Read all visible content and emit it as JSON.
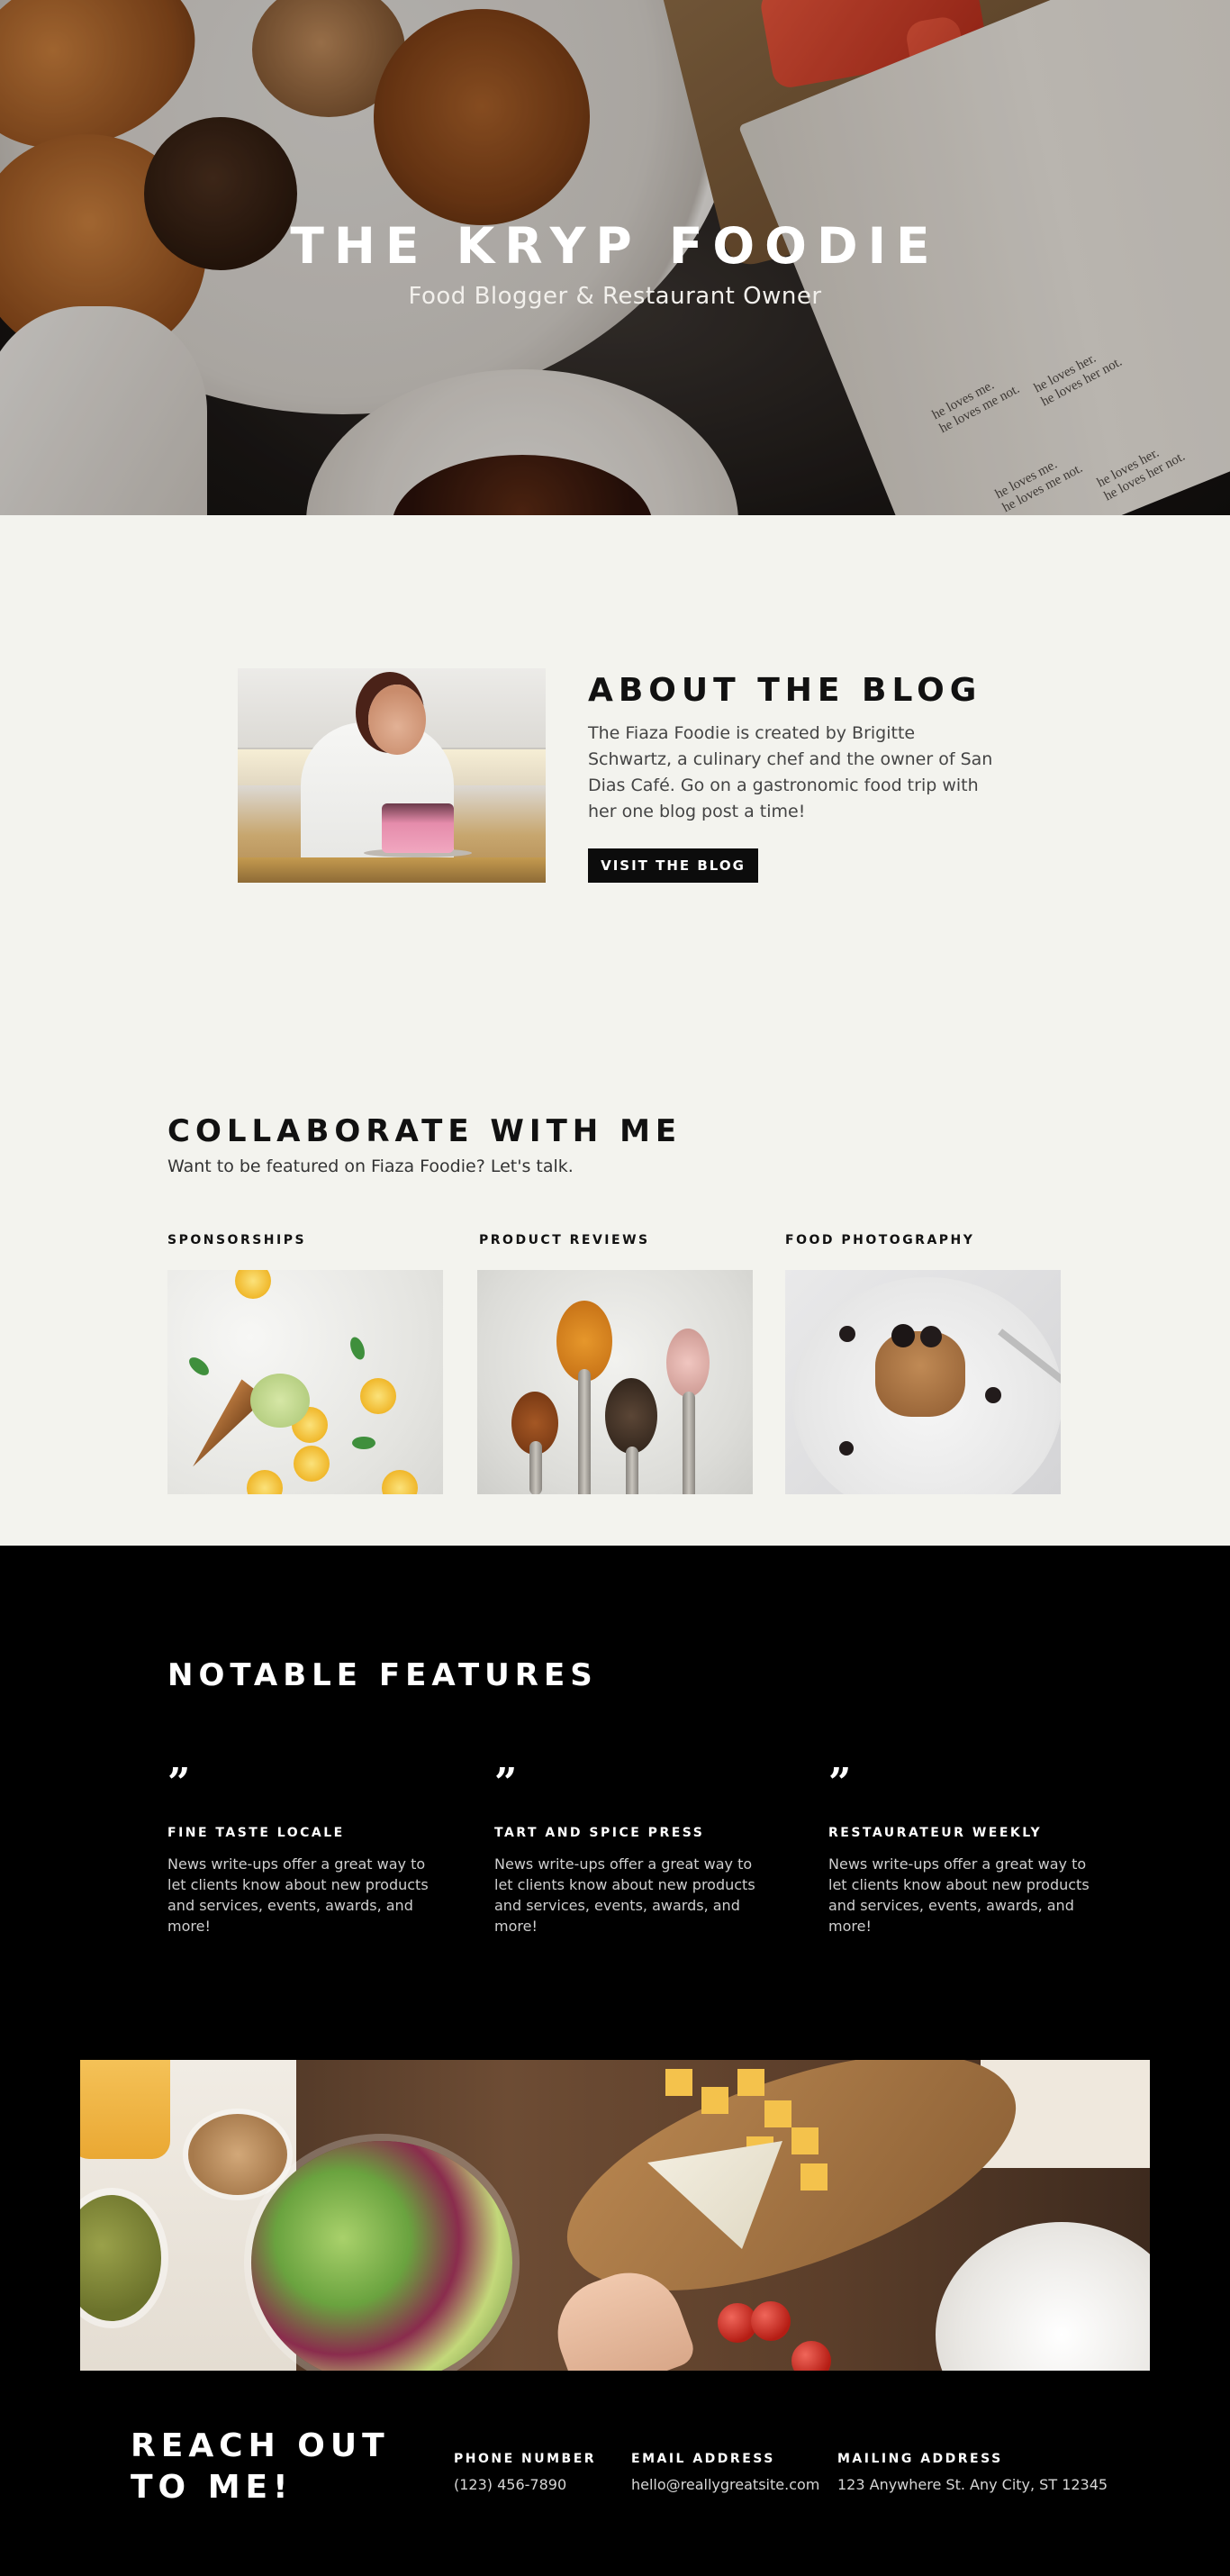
{
  "hero": {
    "title": "THE KRYP FOODIE",
    "subtitle": "Food Blogger & Restaurant Owner",
    "book_text": [
      "he loves me.",
      "he loves me not.",
      "he loves her.",
      "he loves her not.",
      "he loves me.",
      "he loves me not.",
      "he loves her.",
      "he loves her not."
    ]
  },
  "about": {
    "title": "ABOUT THE BLOG",
    "body": "The Fiaza Foodie is created by Brigitte Schwartz, a culinary chef and the owner of San Dias Café. Go on a gastronomic food trip with her one blog post a time!",
    "button_label": "VISIT THE BLOG"
  },
  "collaborate": {
    "title": "COLLABORATE WITH ME",
    "subtitle": "Want to be featured on Fiaza Foodie? Let's talk.",
    "cards": [
      {
        "label": "SPONSORSHIPS"
      },
      {
        "label": "PRODUCT REVIEWS"
      },
      {
        "label": "FOOD PHOTOGRAPHY"
      }
    ]
  },
  "features": {
    "title": "NOTABLE FEATURES",
    "quote_glyph": "”",
    "items": [
      {
        "title": "FINE TASTE LOCALE",
        "body": "News write-ups offer a great way to let clients know about new products and services, events, awards, and more!"
      },
      {
        "title": "TART AND SPICE PRESS",
        "body": "News write-ups offer a great way to let clients know about new products and services, events, awards, and more!"
      },
      {
        "title": "RESTAURATEUR WEEKLY",
        "body": "News write-ups offer a great way to let clients know about new products and services, events, awards, and more!"
      }
    ]
  },
  "contact": {
    "title_line1": "REACH OUT",
    "title_line2": "TO ME!",
    "phone_label": "PHONE NUMBER",
    "phone_value": "(123) 456-7890",
    "email_label": "EMAIL ADDRESS",
    "email_value": "hello@reallygreatsite.com",
    "mail_label": "MAILING ADDRESS",
    "mail_value": "123 Anywhere St. Any City, ST 12345"
  },
  "colors": {
    "page_bg": "#f3f3ee",
    "dark_bg": "#000000",
    "button_bg": "#0c0c0c",
    "text": "#111111"
  },
  "icons": [
    "quote-icon"
  ]
}
